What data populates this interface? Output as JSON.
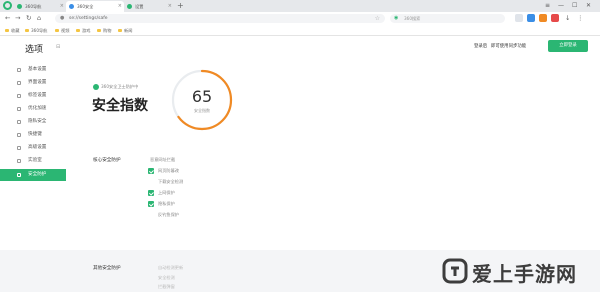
{
  "tabs": [
    {
      "label": "360导航",
      "favicon_color": "#2bb673",
      "active": false
    },
    {
      "label": "360安全",
      "favicon_color": "#3a8ee6",
      "active": true
    },
    {
      "label": "设置",
      "favicon_color": "#2bb673",
      "active": false
    }
  ],
  "address": {
    "url": "se://settings/safe"
  },
  "search": {
    "placeholder": "360搜索"
  },
  "bookmarks": [
    "收藏",
    "360导航",
    "视频",
    "游戏",
    "购物",
    "新闻"
  ],
  "sidebar": {
    "title": "选项",
    "items": [
      {
        "label": "基本设置",
        "active": false
      },
      {
        "label": "界面设置",
        "active": false
      },
      {
        "label": "标签设置",
        "active": false
      },
      {
        "label": "优化加速",
        "active": false
      },
      {
        "label": "隐私安全",
        "active": false
      },
      {
        "label": "快捷键",
        "active": false
      },
      {
        "label": "高级设置",
        "active": false
      },
      {
        "label": "实验室",
        "active": false
      },
      {
        "label": "安全防护",
        "active": true
      }
    ]
  },
  "header": {
    "login_link": "登录后",
    "sync_link": "即可使用同步功能",
    "primary_button": "立即登录"
  },
  "security": {
    "status": "360安全卫士防护中",
    "title": "安全指数",
    "score": "65",
    "score_fraction": 0.65,
    "score_label": "安全指数"
  },
  "core_protection": {
    "heading": "核心安全防护",
    "rows": [
      {
        "label": "恶意网址拦截",
        "checked": false,
        "faint": false,
        "indent": false
      },
      {
        "label": "网页防篡改",
        "checked": true,
        "faint": false,
        "indent": false
      },
      {
        "label": "下载安全检测",
        "checked": false,
        "faint": false,
        "indent": true
      },
      {
        "label": "上网保护",
        "checked": true,
        "faint": false,
        "indent": false
      },
      {
        "label": "隐私保护",
        "checked": true,
        "faint": false,
        "indent": false
      },
      {
        "label": "反钓鱼保护",
        "checked": false,
        "faint": false,
        "indent": true
      },
      {
        "label": "",
        "checked": false,
        "faint": true,
        "indent": true
      },
      {
        "label": "",
        "checked": false,
        "faint": true,
        "indent": true
      }
    ]
  },
  "other_protection": {
    "heading": "其他安全防护",
    "rows": [
      {
        "label": "自动检测更新",
        "faint": true
      },
      {
        "label": "安全检测",
        "faint": true
      },
      {
        "label": "拦截弹窗",
        "faint": true
      }
    ]
  },
  "watermark": {
    "text": "爱上手游网"
  },
  "colors": {
    "accent": "#2bb673",
    "gauge_orange": "#f08a24",
    "gauge_track": "#e9ecef"
  }
}
